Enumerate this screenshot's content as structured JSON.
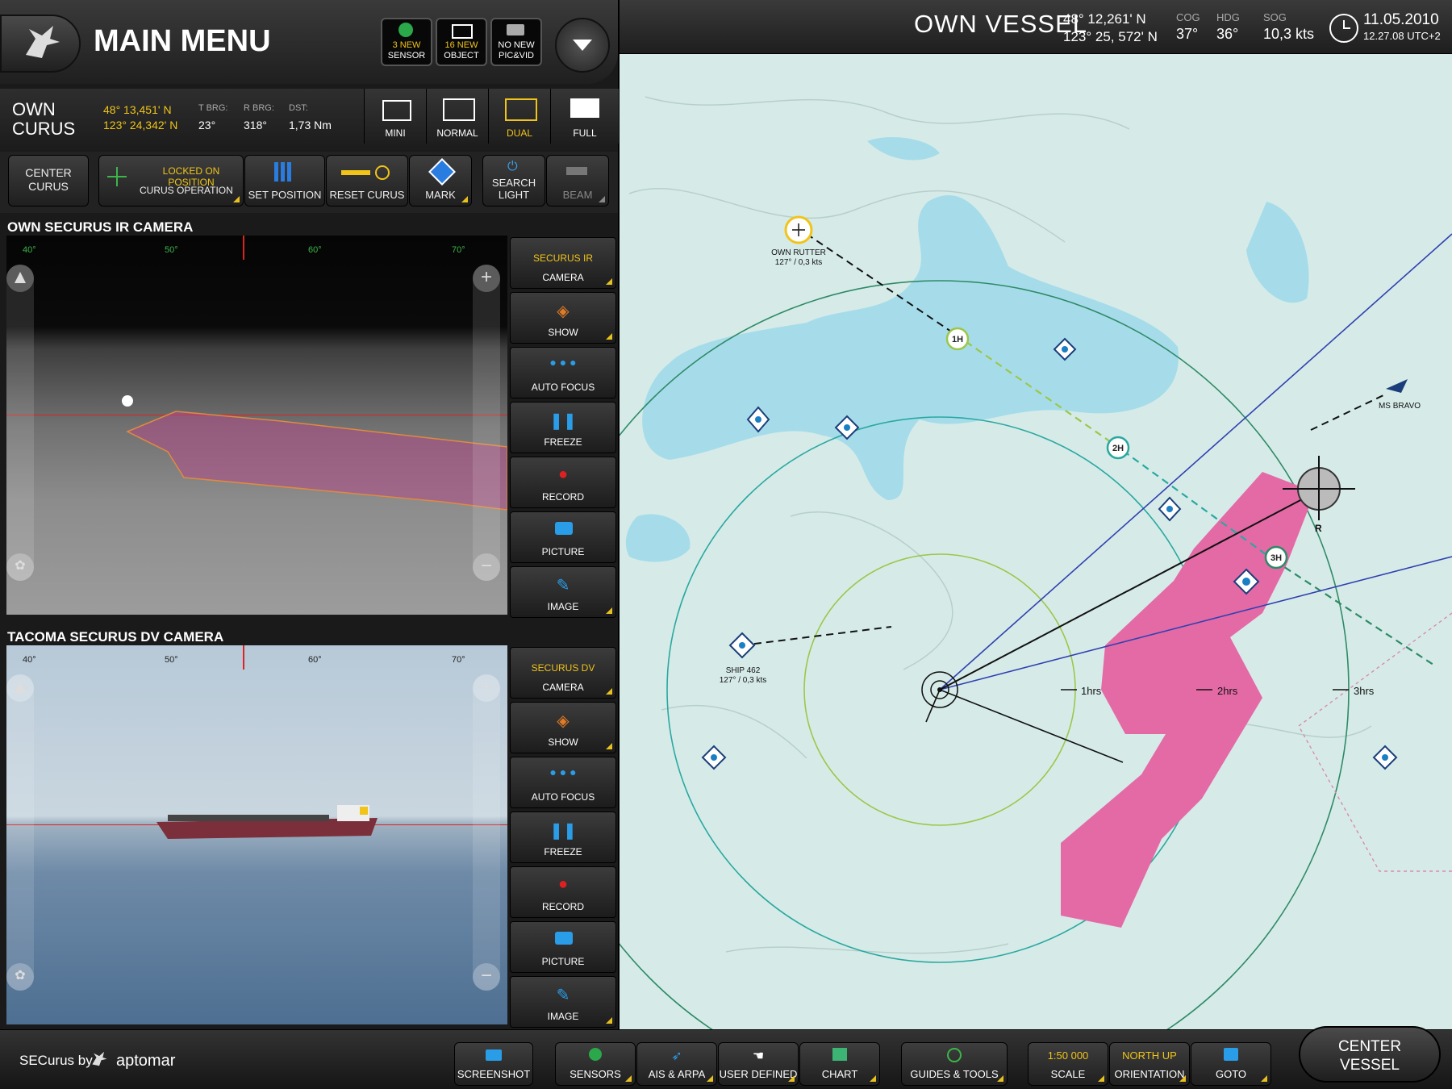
{
  "header": {
    "main_menu": "MAIN MENU",
    "notifications": [
      {
        "line1": "3 NEW",
        "line2": "SENSOR",
        "icon": "globe-sensor-icon"
      },
      {
        "line1": "16 NEW",
        "line2": "OBJECT",
        "icon": "object-list-icon"
      },
      {
        "line1": "NO NEW",
        "line2": "PIC&VID",
        "icon": "camera-list-icon"
      }
    ]
  },
  "own_vessel": {
    "title": "OWN VESSEL",
    "lat": "48° 12,261' N",
    "lon": "123° 25, 572' N",
    "cog_label": "COG",
    "cog": "37°",
    "hdg_label": "HDG",
    "hdg": "36°",
    "sog_label": "SOG",
    "sog": "10,3 kts",
    "date": "11.05.2010",
    "time": "12.27.08 UTC+2"
  },
  "curus": {
    "line1": "OWN",
    "line2": "CURUS",
    "lat": "48° 13,451' N",
    "lon": "123° 24,342' N",
    "tbrg_label": "T BRG:",
    "tbrg": "23°",
    "rbrg_label": "R BRG:",
    "rbrg": "318°",
    "dst_label": "DST:",
    "dst": "1,73 Nm"
  },
  "view_modes": [
    "MINI",
    "NORMAL",
    "DUAL",
    "FULL"
  ],
  "view_selected": "DUAL",
  "controls": {
    "center_curus_1": "CENTER",
    "center_curus_2": "CURUS",
    "locked": "LOCKED ON POSITION",
    "curus_operation": "CURUS OPERATION",
    "set_position": "SET POSITION",
    "reset_curus": "RESET CURUS",
    "mark": "MARK",
    "search_light_1": "SEARCH",
    "search_light_2": "LIGHT",
    "beam": "BEAM"
  },
  "ir_camera": {
    "title": "OWN SECURUS IR CAMERA",
    "scale": [
      "40°",
      "50°",
      "60°",
      "70°"
    ],
    "buttons": [
      {
        "l1": "SECURUS IR",
        "l2": "CAMERA"
      },
      {
        "l1": "",
        "l2": "SHOW"
      },
      {
        "l1": "",
        "l2": "AUTO FOCUS"
      },
      {
        "l1": "",
        "l2": "FREEZE"
      },
      {
        "l1": "",
        "l2": "RECORD"
      },
      {
        "l1": "",
        "l2": "PICTURE"
      },
      {
        "l1": "",
        "l2": "IMAGE"
      }
    ]
  },
  "dv_camera": {
    "title": "TACOMA SECURUS DV CAMERA",
    "scale": [
      "40°",
      "50°",
      "60°",
      "70°"
    ],
    "buttons": [
      {
        "l1": "SECURUS DV",
        "l2": "CAMERA"
      },
      {
        "l1": "",
        "l2": "SHOW"
      },
      {
        "l1": "",
        "l2": "AUTO FOCUS"
      },
      {
        "l1": "",
        "l2": "FREEZE"
      },
      {
        "l1": "",
        "l2": "RECORD"
      },
      {
        "l1": "",
        "l2": "PICTURE"
      },
      {
        "l1": "",
        "l2": "IMAGE"
      }
    ]
  },
  "map": {
    "own_rutter_1": "OWN RUTTER",
    "own_rutter_2": "127° / 0,3 kts",
    "ship_462_1": "SHIP 462",
    "ship_462_2": "127° / 0,3 kts",
    "ms_bravo": "MS BRAVO",
    "h1": "1H",
    "h2": "2H",
    "h3": "3H",
    "r1": "1hrs",
    "r2": "2hrs",
    "r3": "3hrs",
    "curus_marker": "R",
    "colors": {
      "sea_shallow": "#a6dcea",
      "sea": "#d6ebe8",
      "zone": "#e46aa6",
      "ring": "#2f8a66"
    }
  },
  "bottom": {
    "brand_1": "SECurus by",
    "brand_2": "aptomar",
    "buttons": [
      {
        "l1": "",
        "l2": "SCREENSHOT",
        "icon": "camera-icon"
      },
      {
        "l1": "",
        "l2": "SENSORS",
        "icon": "globe-icon"
      },
      {
        "l1": "",
        "l2": "AIS & ARPA",
        "icon": "ais-icon"
      },
      {
        "l1": "",
        "l2": "USER DEFINED",
        "icon": "hand-icon"
      },
      {
        "l1": "",
        "l2": "CHART",
        "icon": "chart-icon"
      },
      {
        "l1": "",
        "l2": "GUIDES & TOOLS",
        "icon": "guides-icon"
      },
      {
        "l1": "1:50 000",
        "l2": "SCALE",
        "icon": ""
      },
      {
        "l1": "NORTH UP",
        "l2": "ORIENTATION",
        "icon": ""
      },
      {
        "l1": "",
        "l2": "GOTO",
        "icon": "goto-icon"
      }
    ],
    "center_vessel_1": "CENTER",
    "center_vessel_2": "VESSEL"
  }
}
